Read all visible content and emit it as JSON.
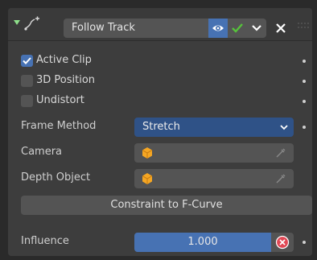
{
  "header": {
    "constraint_name": "Follow Track"
  },
  "checkboxes": [
    {
      "label": "Active Clip",
      "checked": true
    },
    {
      "label": "3D Position",
      "checked": false
    },
    {
      "label": "Undistort",
      "checked": false
    }
  ],
  "frame_method": {
    "label": "Frame Method",
    "value": "Stretch"
  },
  "camera": {
    "label": "Camera",
    "value": ""
  },
  "depth_object": {
    "label": "Depth Object",
    "value": ""
  },
  "action_button": {
    "label": "Constraint to F-Curve"
  },
  "influence": {
    "label": "Influence",
    "value": "1.000",
    "fraction": 1.0
  },
  "colors": {
    "accent": "#4772b3",
    "dropdown": "#2f5287",
    "panel": "#3d3d3d",
    "enabled_check": "#56c23b",
    "remove_keyframe": "#e04855"
  },
  "icons": [
    "disclosure-triangle-icon",
    "constraint-icon",
    "eye-icon",
    "checkmark-icon",
    "chevron-down-icon",
    "close-icon",
    "object-cube-icon",
    "eyedropper-icon",
    "clear-keyframe-icon"
  ]
}
